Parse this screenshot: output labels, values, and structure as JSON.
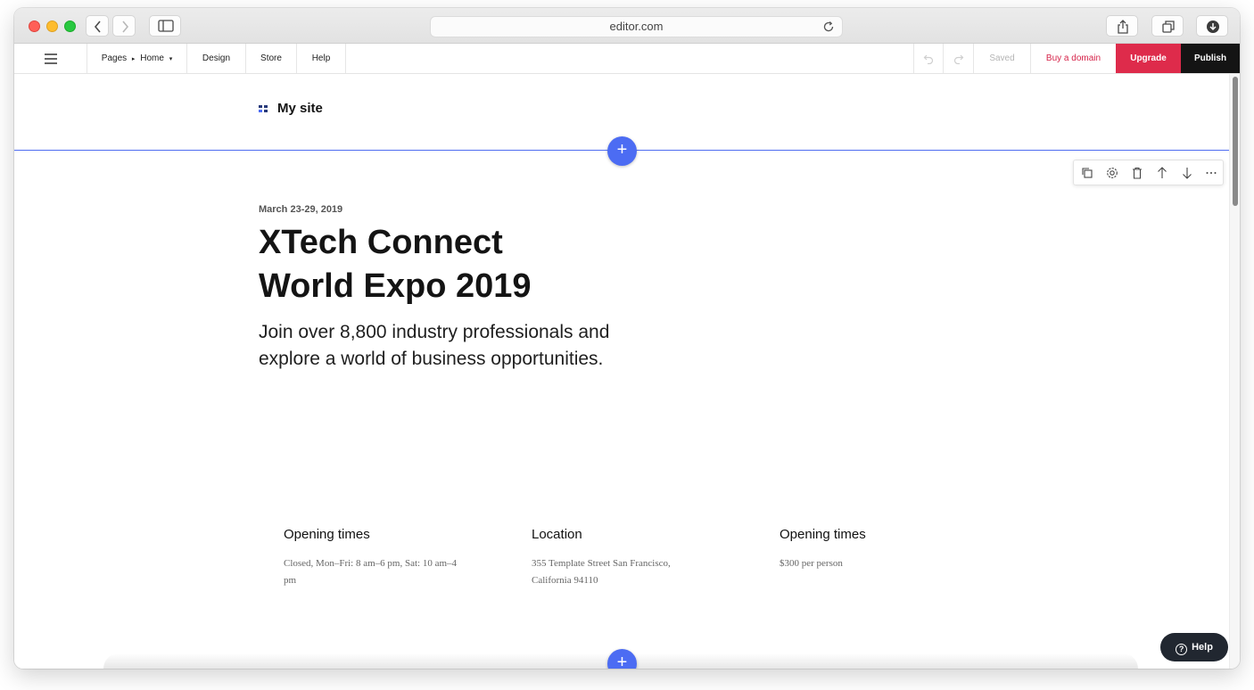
{
  "browser": {
    "url": "editor.com"
  },
  "toolbar": {
    "pages_label": "Pages",
    "current_page": "Home",
    "design_label": "Design",
    "store_label": "Store",
    "help_label": "Help",
    "saved_label": "Saved",
    "buy_domain_label": "Buy a domain",
    "upgrade_label": "Upgrade",
    "publish_label": "Publish"
  },
  "site": {
    "name": "My site"
  },
  "hero": {
    "date": "March 23-29, 2019",
    "title_line1": "XTech Connect",
    "title_line2": "World Expo 2019",
    "subtitle": "Join over 8,800 industry professionals and explore a world of business opportunities."
  },
  "info": [
    {
      "heading": "Opening times",
      "text": "Closed, Mon–Fri: 8 am–6 pm, Sat: 10 am–4 pm"
    },
    {
      "heading": "Location",
      "text": "355 Template Street San Francisco, California 94110"
    },
    {
      "heading": "Opening times",
      "text": "$300 per person"
    }
  ],
  "help_widget": {
    "label": "Help"
  },
  "colors": {
    "accent_blue": "#4c6cf3",
    "upgrade_red": "#de2b4b",
    "domain_red": "#d6244a",
    "publish_black": "#141414"
  }
}
